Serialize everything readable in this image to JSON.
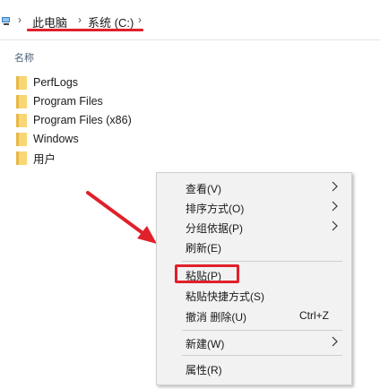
{
  "address_bar": {
    "crumbs": [
      "此电脑",
      "系统 (C:)"
    ]
  },
  "file_list": {
    "column_name": "名称",
    "items": [
      {
        "name": "PerfLogs",
        "icon": "folder-icon"
      },
      {
        "name": "Program Files",
        "icon": "folder-icon"
      },
      {
        "name": "Program Files (x86)",
        "icon": "folder-icon"
      },
      {
        "name": "Windows",
        "icon": "folder-icon"
      },
      {
        "name": "用户",
        "icon": "folder-icon"
      }
    ]
  },
  "context_menu": {
    "items": [
      {
        "label": "查看(V)",
        "submenu": true
      },
      {
        "label": "排序方式(O)",
        "submenu": true
      },
      {
        "label": "分组依据(P)",
        "submenu": true
      },
      {
        "label": "刷新(E)"
      },
      {
        "label": "粘贴(P)",
        "highlighted": true
      },
      {
        "label": "粘贴快捷方式(S)"
      },
      {
        "label": "撤消 删除(U)",
        "shortcut": "Ctrl+Z"
      },
      {
        "label": "新建(W)",
        "submenu": true
      },
      {
        "label": "属性(R)"
      }
    ]
  },
  "colors": {
    "annotation_red": "#e0202a",
    "folder_yellow": "#f8d675",
    "menu_background": "#f2f2f2"
  }
}
